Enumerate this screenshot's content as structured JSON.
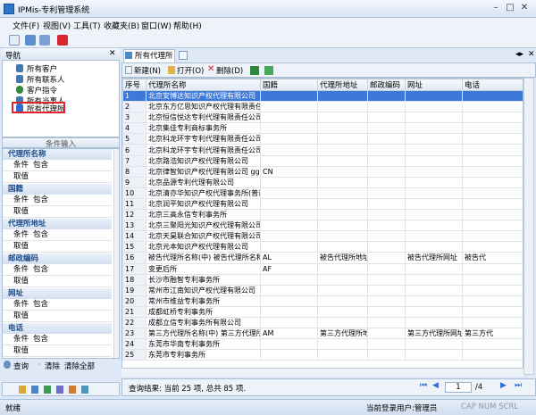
{
  "app": {
    "title": "IPMis-专利管理系统"
  },
  "menu": [
    "文件(F)",
    "视图(V)",
    "工具(T)",
    "收藏夹(B)",
    "窗口(W)",
    "帮助(H)"
  ],
  "nav": {
    "title": "导航",
    "items": [
      "所有客户",
      "所有联系人",
      "客户指令",
      "所有当事人",
      "所有代理所"
    ],
    "selected": "所有代理所"
  },
  "conditions": {
    "title": "条件输入",
    "groups": [
      {
        "name": "代理所名称",
        "cond_label": "条件",
        "cond_value": "包含",
        "val_label": "取值"
      },
      {
        "name": "国籍",
        "cond_label": "条件",
        "cond_value": "包含",
        "val_label": "取值"
      },
      {
        "name": "代理所地址",
        "cond_label": "条件",
        "cond_value": "包含",
        "val_label": "取值"
      },
      {
        "name": "邮政编码",
        "cond_label": "条件",
        "cond_value": "包含",
        "val_label": "取值"
      },
      {
        "name": "网址",
        "cond_label": "条件",
        "cond_value": "包含",
        "val_label": "取值"
      },
      {
        "name": "电话",
        "cond_label": "条件",
        "cond_value": "包含",
        "val_label": "取值"
      }
    ],
    "query_btn": "查询",
    "clear_btn": "清除",
    "clear_all_btn": "清除全部"
  },
  "tab": {
    "label": "所有代理所"
  },
  "subtoolbar": {
    "new": "新建(N)",
    "open": "打开(O)",
    "delete": "删除(D)"
  },
  "grid": {
    "headers": [
      "序号",
      "代理所名称",
      "国籍",
      "代理所地址",
      "邮政编码",
      "网址",
      "电话"
    ],
    "rows": [
      [
        "1",
        "北京安博达知识产权代理有限公司",
        "",
        "",
        "",
        "",
        ""
      ],
      [
        "2",
        "北京东方亿思知识产权代理有限责任",
        "",
        "",
        "",
        "",
        ""
      ],
      [
        "3",
        "北京恒信悦达专利代理有限责任公司",
        "",
        "",
        "",
        "",
        ""
      ],
      [
        "4",
        "北京集佳专利商标事务所",
        "",
        "",
        "",
        "",
        ""
      ],
      [
        "5",
        "北京科龙环宇专利代理有限责任公司",
        "",
        "",
        "",
        "",
        ""
      ],
      [
        "6",
        "北京科龙环宇专利代理有限责任公司",
        "",
        "",
        "",
        "",
        ""
      ],
      [
        "7",
        "北京路浩知识产权代理有限公司",
        "",
        "",
        "",
        "",
        ""
      ],
      [
        "8",
        "北京律智知识产权代理有限公司    gg",
        "CN",
        "",
        "",
        "",
        ""
      ],
      [
        "9",
        "北京品源专利代理有限公司",
        "",
        "",
        "",
        "",
        ""
      ],
      [
        "10",
        "北京清亦华知识产权代理事务所(普通",
        "",
        "",
        "",
        "",
        ""
      ],
      [
        "11",
        "北京润平知识产权代理有限公司",
        "",
        "",
        "",
        "",
        ""
      ],
      [
        "12",
        "北京三高永信专利事务所",
        "",
        "",
        "",
        "",
        ""
      ],
      [
        "13",
        "北京三聚阳光知识产权代理有限公司",
        "",
        "",
        "",
        "",
        ""
      ],
      [
        "14",
        "北京天昊联合知识产权代理有限公司",
        "",
        "",
        "",
        "",
        ""
      ],
      [
        "15",
        "北京元本知识产权代理有限公司",
        "",
        "",
        "",
        "",
        ""
      ],
      [
        "16",
        "被告代理所名称(中) 被告代理所名称",
        "AL",
        "被告代理所地址(中) 被告",
        "",
        "被告代理所网址",
        "被告代"
      ],
      [
        "17",
        "变更后所",
        "AF",
        "",
        "",
        "",
        ""
      ],
      [
        "18",
        "长沙市融智专利事务所",
        "",
        "",
        "",
        "",
        ""
      ],
      [
        "19",
        "常州市江南知识产权代理有限公司",
        "",
        "",
        "",
        "",
        ""
      ],
      [
        "20",
        "常州市维益专利事务所",
        "",
        "",
        "",
        "",
        ""
      ],
      [
        "21",
        "成都虹桥专利事务所",
        "",
        "",
        "",
        "",
        ""
      ],
      [
        "22",
        "成都立信专利事务所有限公司",
        "",
        "",
        "",
        "",
        ""
      ],
      [
        "23",
        "第三方代理所名称(中) 第三方代理所",
        "AM",
        "第三方代理所地址(中) 第三",
        "",
        "第三方代理所网址",
        "第三方代"
      ],
      [
        "24",
        "东莞市华南专利事务所",
        "",
        "",
        "",
        "",
        ""
      ],
      [
        "25",
        "东莞市专利事务所",
        "",
        "",
        "",
        "",
        ""
      ]
    ],
    "selected_row": 0
  },
  "query_result": "查询结果: 当前 25 项, 总共 85 项.",
  "pager": {
    "current": "1",
    "total": "/4"
  },
  "status": {
    "left": "就绪",
    "user": "当前登录用户:管理员",
    "indicators": "CAP  NUM  SCRL"
  },
  "colors": {
    "accent": "#3d7ad7",
    "highlight": "#e0232d"
  }
}
